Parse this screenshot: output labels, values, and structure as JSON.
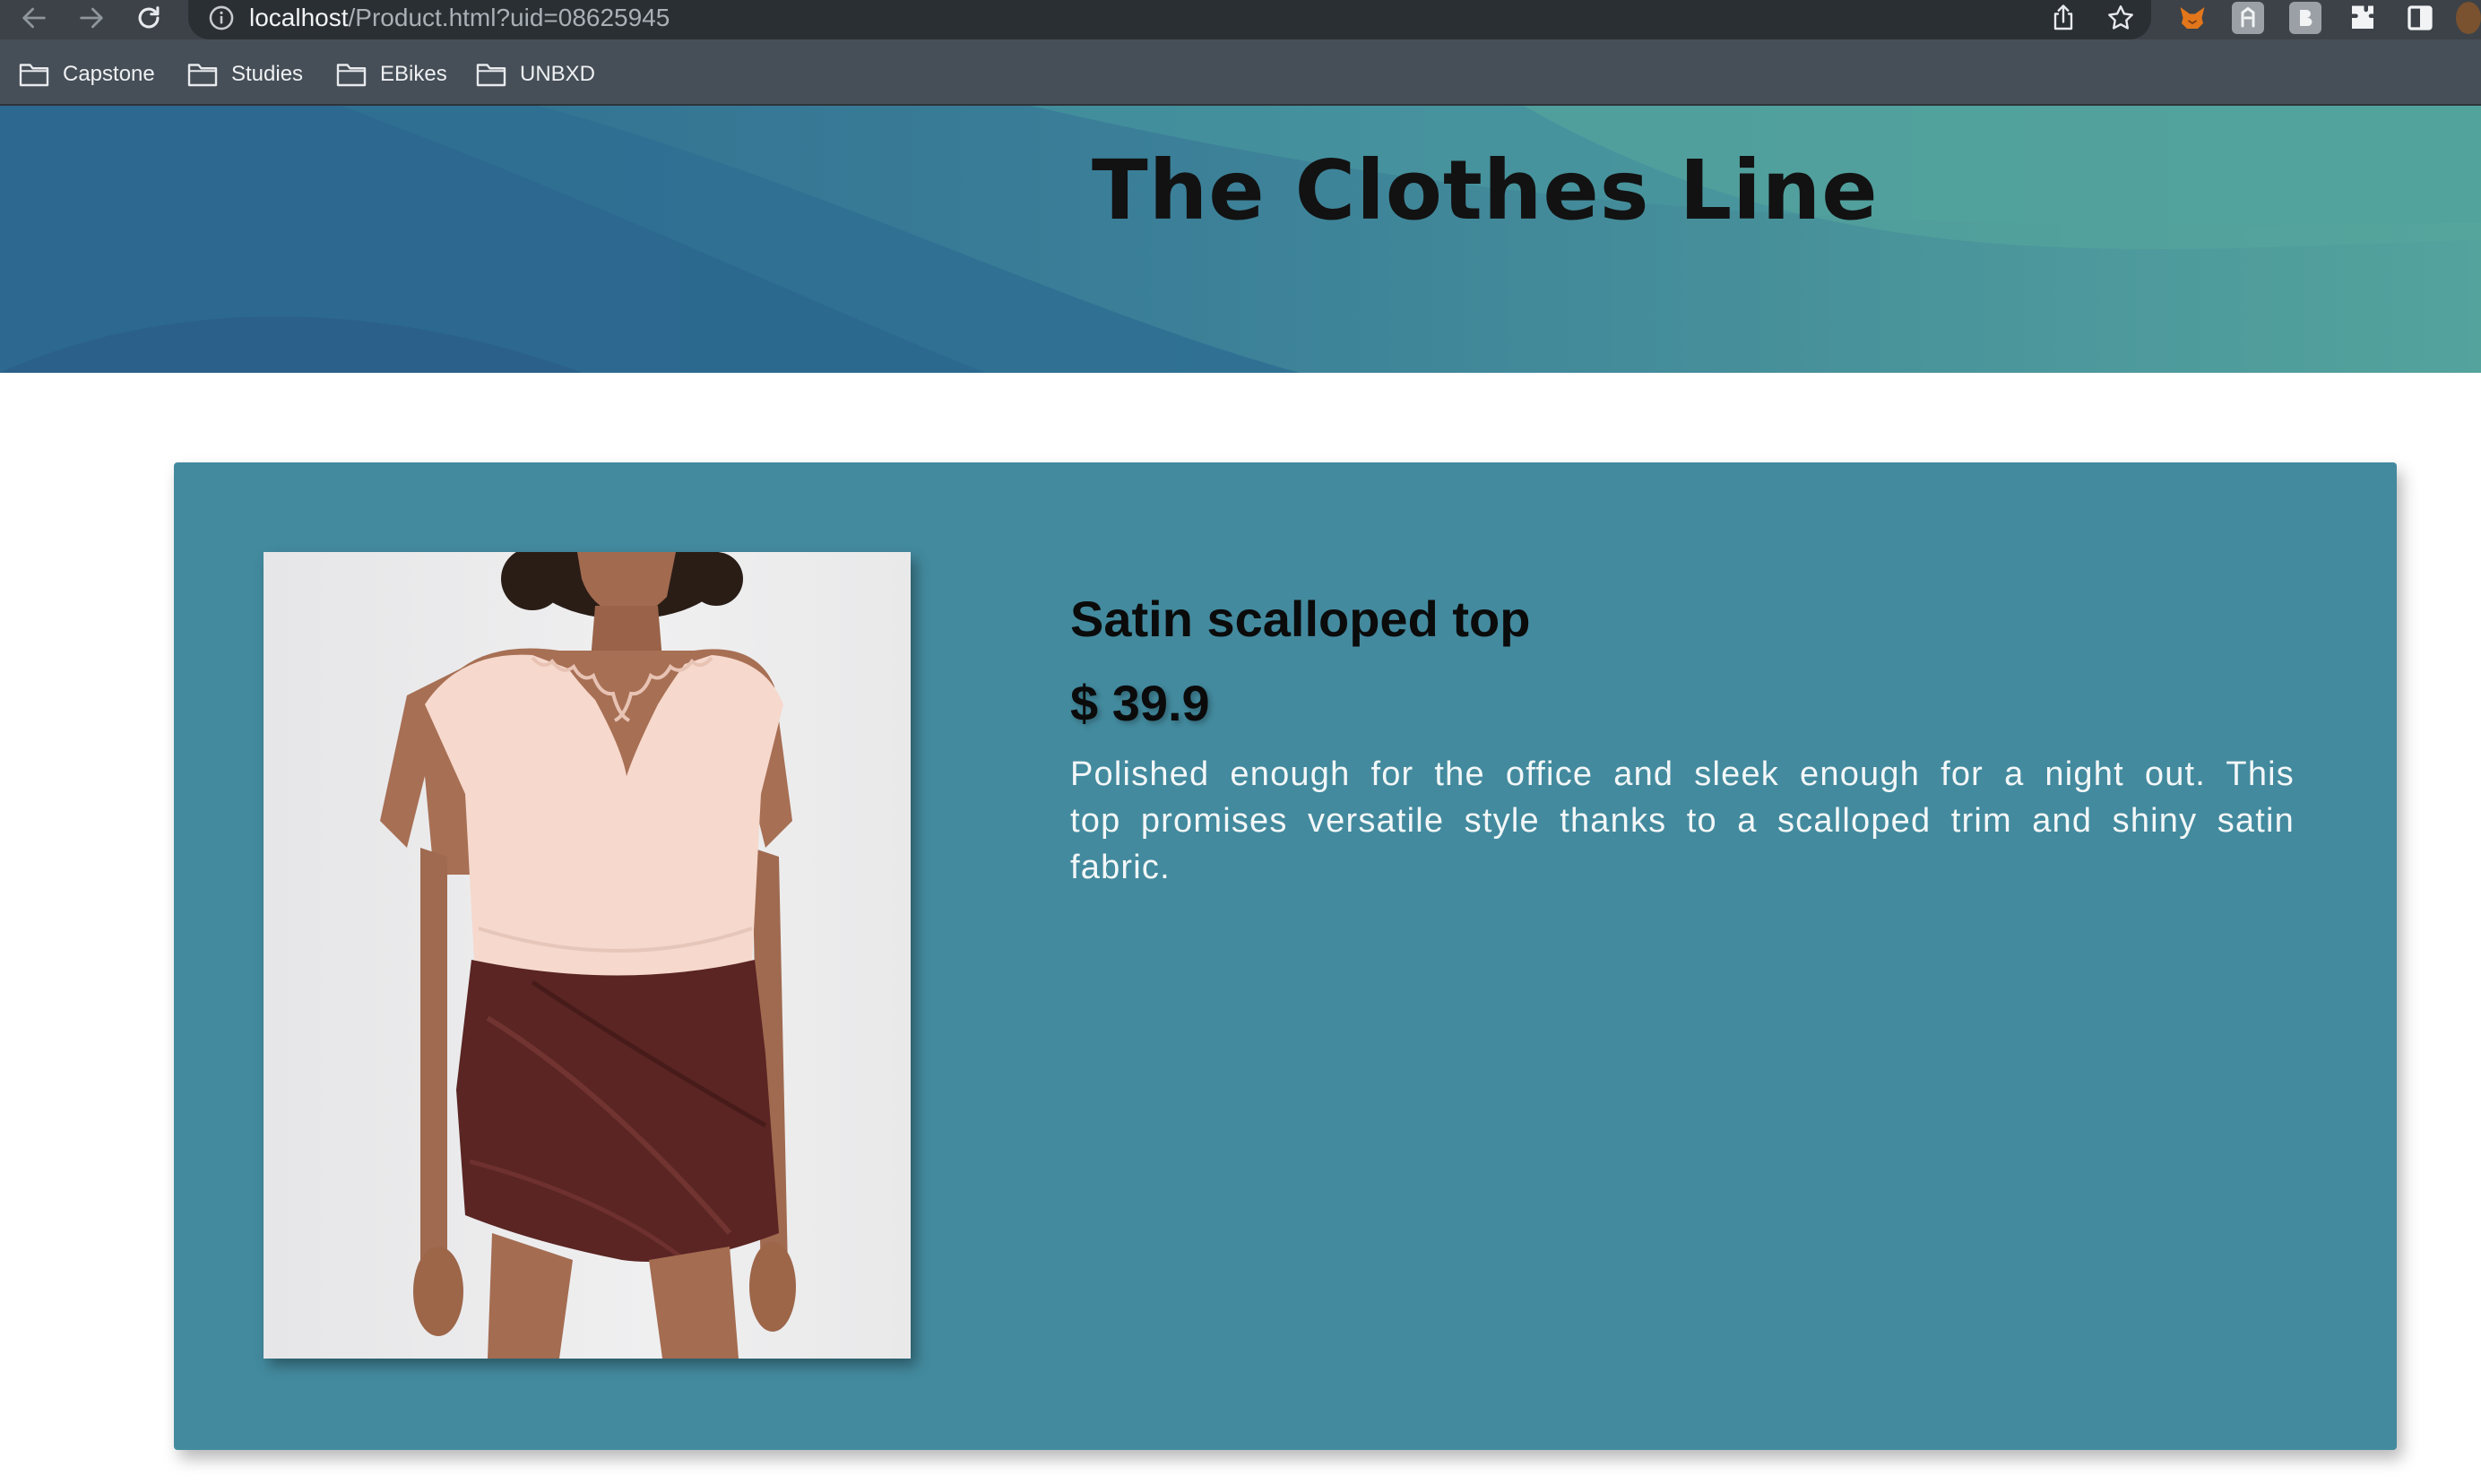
{
  "browser": {
    "url_host": "localhost",
    "url_path": "/Product.html?uid=08625945"
  },
  "bookmarks": [
    {
      "label": "Capstone"
    },
    {
      "label": "Studies"
    },
    {
      "label": "EBikes"
    },
    {
      "label": "UNBXD"
    }
  ],
  "site": {
    "title": "The Clothes Line"
  },
  "product": {
    "name": "Satin scalloped top",
    "price": "$ 39.9",
    "description": "Polished enough for the office and sleek enough for a night out. This top promises versatile style thanks to a scalloped trim and shiny satin fabric."
  },
  "icons": {
    "back": "arrow-left-icon",
    "forward": "arrow-right-icon",
    "reload": "reload-icon",
    "site_info": "info-icon",
    "share": "share-icon",
    "bookmark": "star-icon",
    "extensions": "puzzle-icon",
    "side_panel": "side-panel-icon",
    "bookmark_folder": "folder-icon"
  },
  "colors": {
    "card": "#438a9e",
    "banner_dark": "#2e6b8f",
    "banner_light": "#52a39c",
    "chrome_toolbar": "#3c4248",
    "bookmark_bar": "#464e57"
  }
}
